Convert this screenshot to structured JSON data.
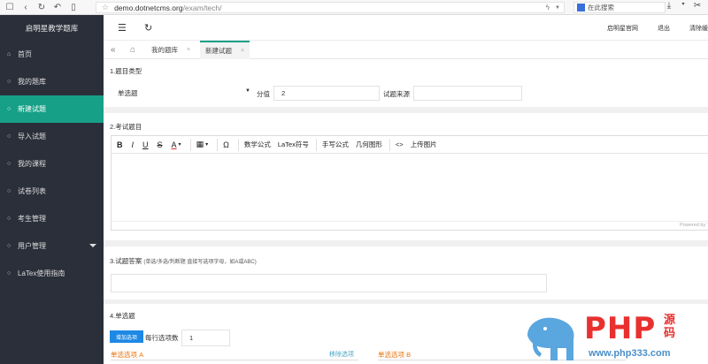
{
  "browser": {
    "url_domain": "demo.dotnetcms.org",
    "url_path": "/exam/tech/",
    "search_placeholder": "在此搜索"
  },
  "sidebar": {
    "brand": "启明星教学题库",
    "items": [
      {
        "label": "首页",
        "icon": "home-icon"
      },
      {
        "label": "我的题库",
        "icon": "circle-icon"
      },
      {
        "label": "新建试题",
        "icon": "circle-icon",
        "active": true
      },
      {
        "label": "导入试题",
        "icon": "circle-icon"
      },
      {
        "label": "我的课程",
        "icon": "circle-icon"
      },
      {
        "label": "试卷列表",
        "icon": "circle-icon"
      },
      {
        "label": "考生管理",
        "icon": "circle-icon"
      },
      {
        "label": "用户管理",
        "icon": "circle-icon",
        "has_submenu": true
      },
      {
        "label": "LaTex使用指南",
        "icon": "circle-icon"
      }
    ]
  },
  "header": {
    "links": [
      "启明星官网",
      "退出",
      "清除缓"
    ]
  },
  "tabs": [
    {
      "label": "我的题库"
    },
    {
      "label": "新建试题",
      "active": true
    }
  ],
  "form": {
    "section1_title": "1.题目类型",
    "question_type": "单选题",
    "score_label": "分值",
    "score_value": "2",
    "source_label": "试题来源",
    "source_value": "",
    "section2_title": "2.考试题目",
    "toolbar": {
      "bold": "B",
      "italic": "I",
      "underline": "U",
      "strike": "S",
      "color": "A",
      "table": "▦",
      "omega": "Ω",
      "math_formula": "数学公式",
      "latex_symbol": "LaTex符号",
      "handwrite_formula": "手写公式",
      "geometry": "几何图形",
      "code": "<>",
      "upload_image": "上传图片"
    },
    "editor_status": "Powered by T",
    "section3_title": "3.试题答案",
    "section3_hint": "(单选/多选/判断题 直接写选项字母，如A或ABC)",
    "answer_value": "",
    "section4_title": "4.单选题",
    "add_option_button": "增加选项",
    "per_row_label": "每行选项数",
    "per_row_value": "1",
    "option_a_label": "单选选项 A",
    "remove_option": "移除选项",
    "option_b_label": "单选选项 B"
  },
  "watermark": {
    "brand": "PHP",
    "cn": "源码",
    "url": "www.php333.com"
  }
}
